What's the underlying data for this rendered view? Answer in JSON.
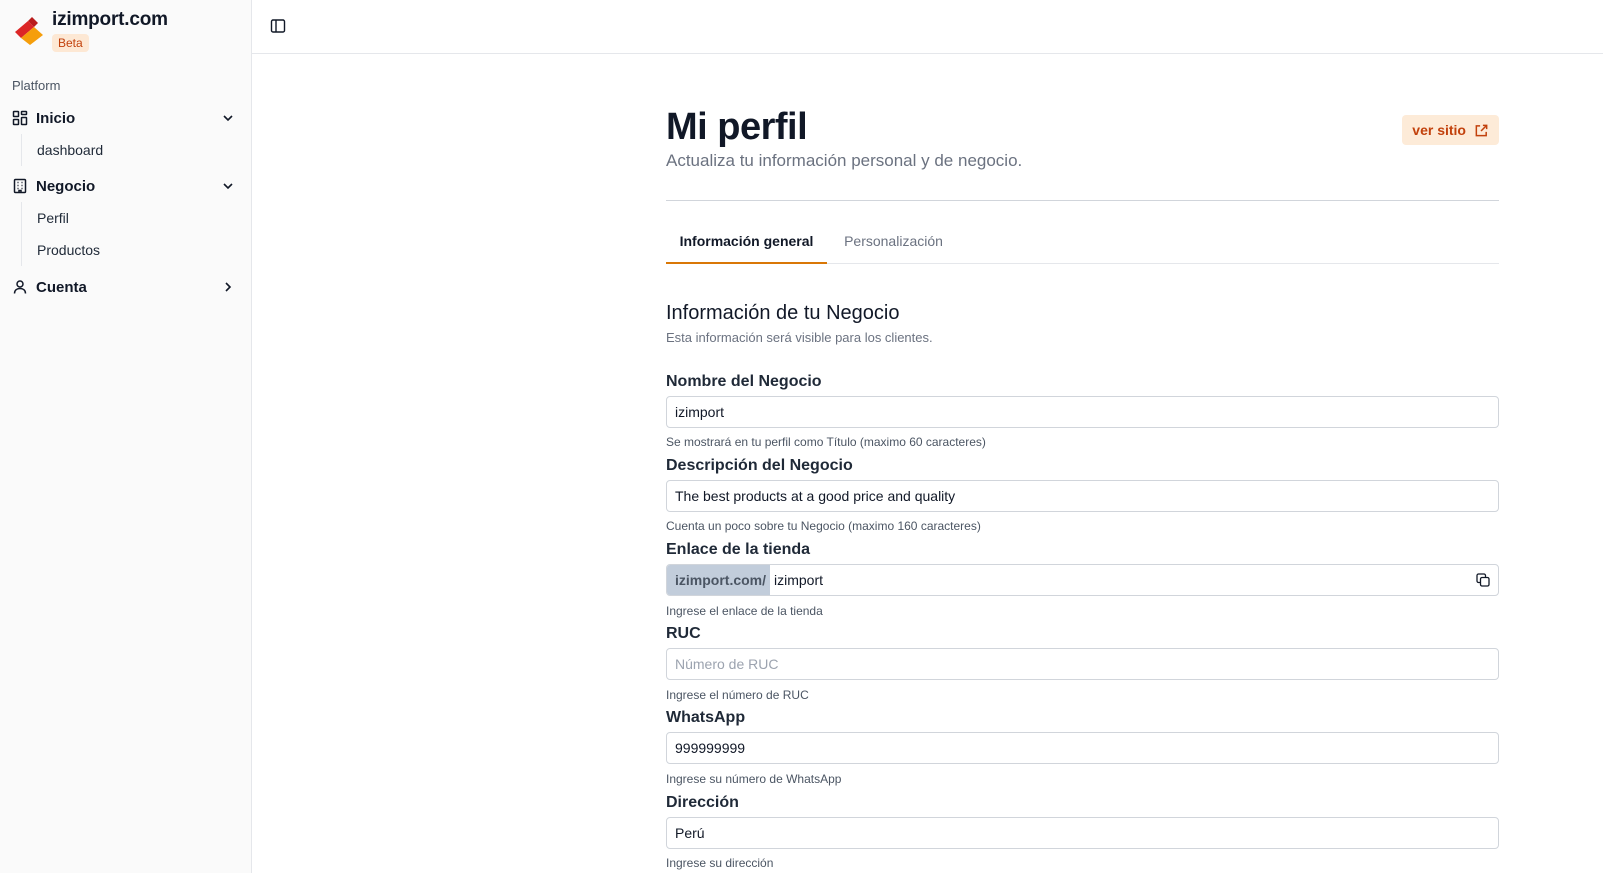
{
  "brand": {
    "name": "izimport.com",
    "badge": "Beta",
    "logo_icon": "izimport-logo-icon"
  },
  "sidebar": {
    "section_label": "Platform",
    "groups": [
      {
        "label": "Inicio",
        "icon": "layout-grid-icon",
        "expanded": true,
        "items": [
          {
            "label": "dashboard"
          }
        ]
      },
      {
        "label": "Negocio",
        "icon": "building-icon",
        "expanded": true,
        "items": [
          {
            "label": "Perfil"
          },
          {
            "label": "Productos"
          }
        ]
      },
      {
        "label": "Cuenta",
        "icon": "user-icon",
        "expanded": false,
        "items": []
      }
    ]
  },
  "header": {
    "toggle_icon": "sidebar-toggle-icon"
  },
  "page": {
    "title": "Mi perfil",
    "subtitle": "Actualiza tu información personal y de negocio.",
    "site_button": "ver sitio"
  },
  "tabs": [
    {
      "label": "Información general",
      "active": true
    },
    {
      "label": "Personalización",
      "active": false
    }
  ],
  "section": {
    "title": "Información de tu Negocio",
    "description": "Esta información será visible para los clientes."
  },
  "fields": {
    "name": {
      "label": "Nombre del Negocio",
      "value": "izimport",
      "placeholder": "",
      "help": "Se mostrará en tu perfil como Título (maximo 60 caracteres)"
    },
    "description": {
      "label": "Descripción del Negocio",
      "value": "The best products at a good price and quality",
      "placeholder": "",
      "help": "Cuenta un poco sobre tu Negocio (maximo 160 caracteres)"
    },
    "link": {
      "label": "Enlace de la tienda",
      "prefix": "izimport.com/",
      "value": "izimport",
      "help": "Ingrese el enlace de la tienda"
    },
    "ruc": {
      "label": "RUC",
      "value": "",
      "placeholder": "Número de RUC",
      "help": "Ingrese el número de RUC"
    },
    "whatsapp": {
      "label": "WhatsApp",
      "value": "999999999",
      "placeholder": "",
      "help": "Ingrese su número de WhatsApp"
    },
    "address": {
      "label": "Dirección",
      "value": "Perú",
      "placeholder": "",
      "help": "Ingrese su dirección"
    }
  },
  "colors": {
    "accent": "#d97706",
    "accent_text": "#c2410c",
    "accent_bg": "#fdebd8",
    "prefix_bg": "#c2cddb"
  }
}
